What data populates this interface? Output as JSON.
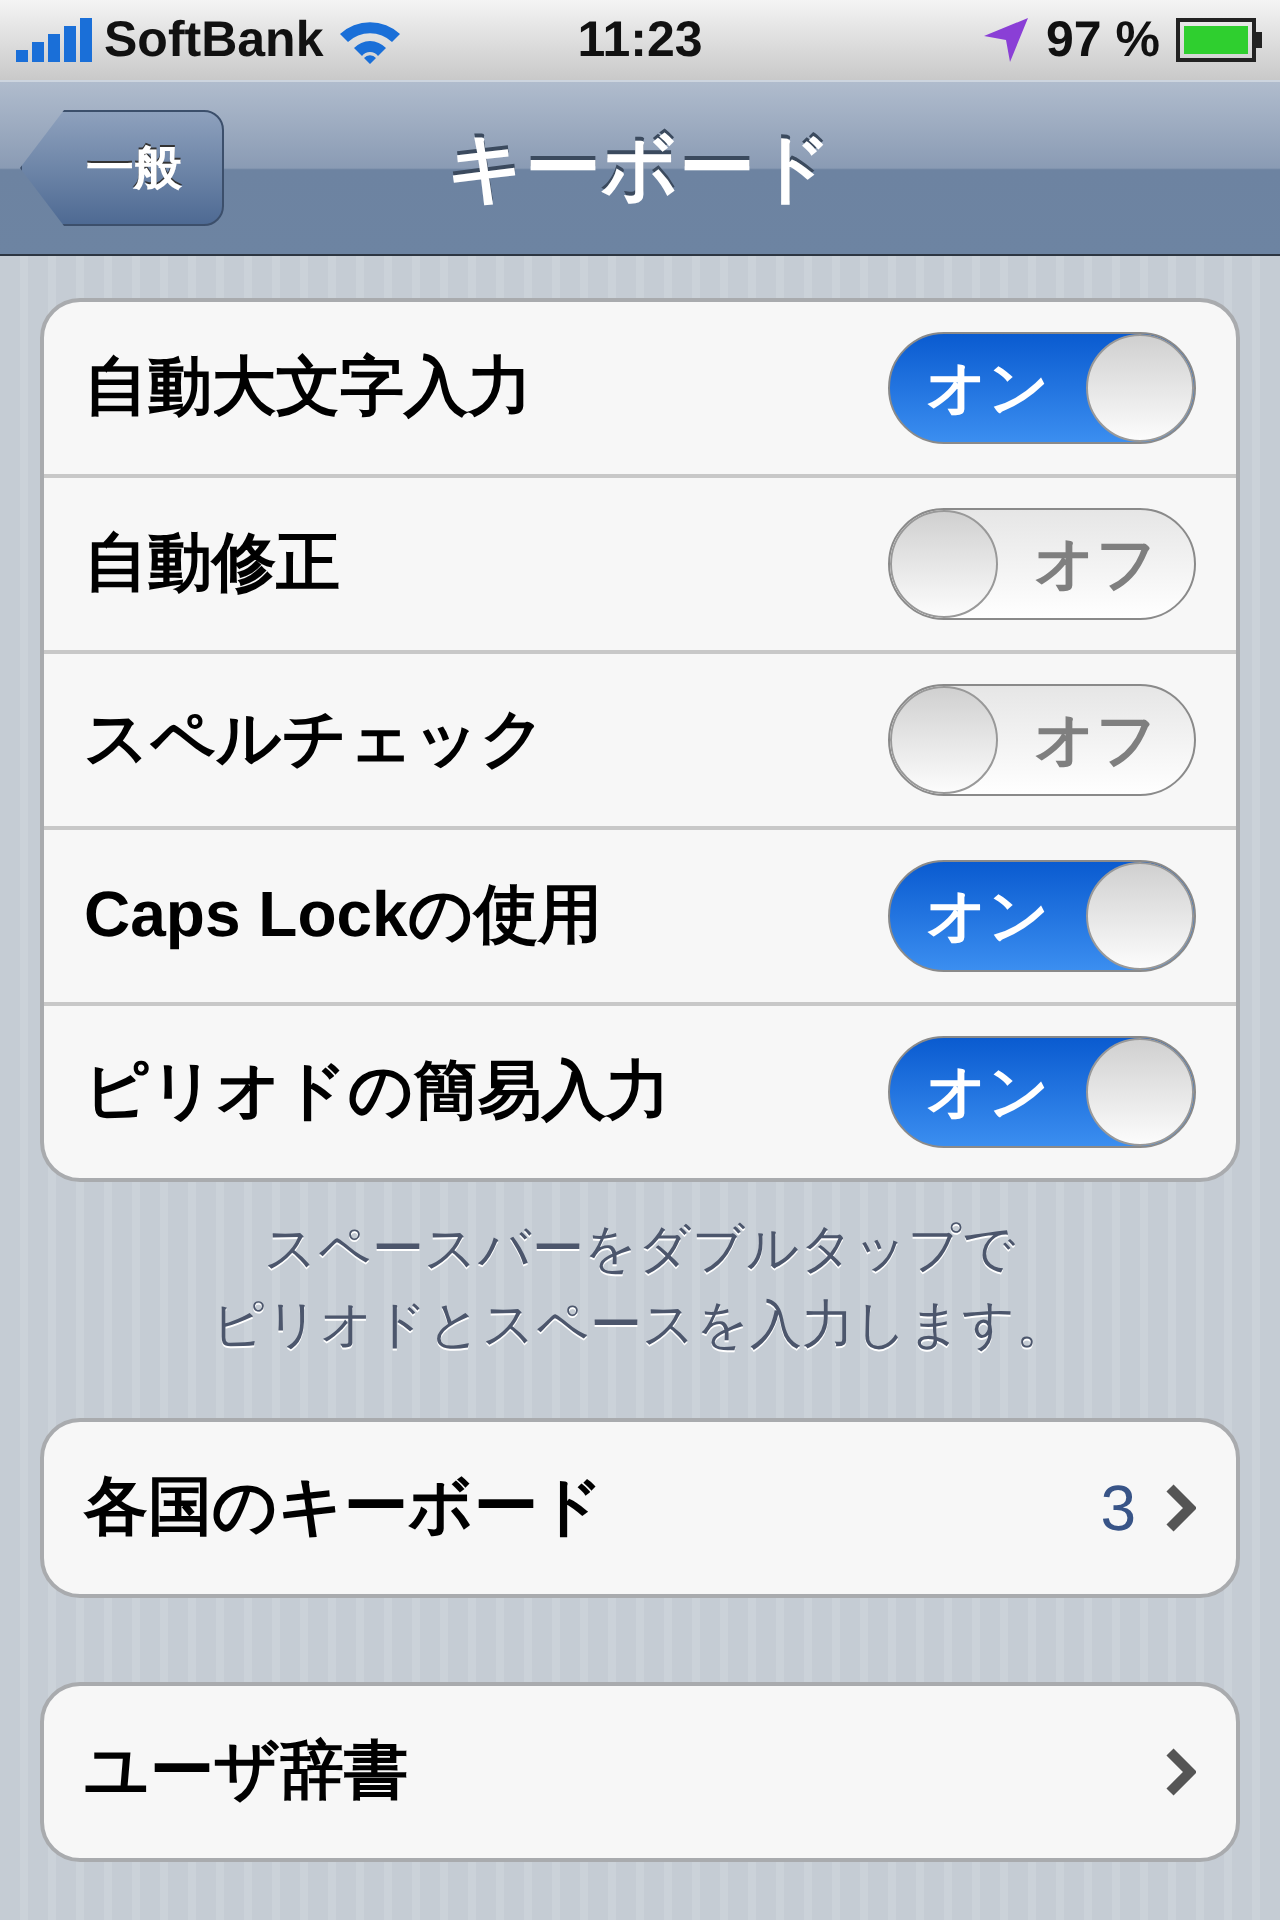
{
  "status_bar": {
    "carrier": "SoftBank",
    "time": "11:23",
    "battery": "97 %"
  },
  "nav_bar": {
    "back": "一般",
    "title": "キーボード"
  },
  "settings": [
    {
      "label": "自動大文字入力",
      "on": true,
      "switch_label": "オン"
    },
    {
      "label": "自動修正",
      "on": false,
      "switch_label": "オフ"
    },
    {
      "label": "スペルチェック",
      "on": false,
      "switch_label": "オフ"
    },
    {
      "label": "Caps Lockの使用",
      "on": true,
      "switch_label": "オン"
    },
    {
      "label": "ピリオドの簡易入力",
      "on": true,
      "switch_label": "オン"
    }
  ],
  "footer": [
    "スペースバーをダブルタップで",
    "ピリオドとスペースを入力します。"
  ],
  "groups": [
    {
      "label": "各国のキーボード",
      "value": "3"
    },
    {
      "label": "ユーザ辞書"
    }
  ]
}
